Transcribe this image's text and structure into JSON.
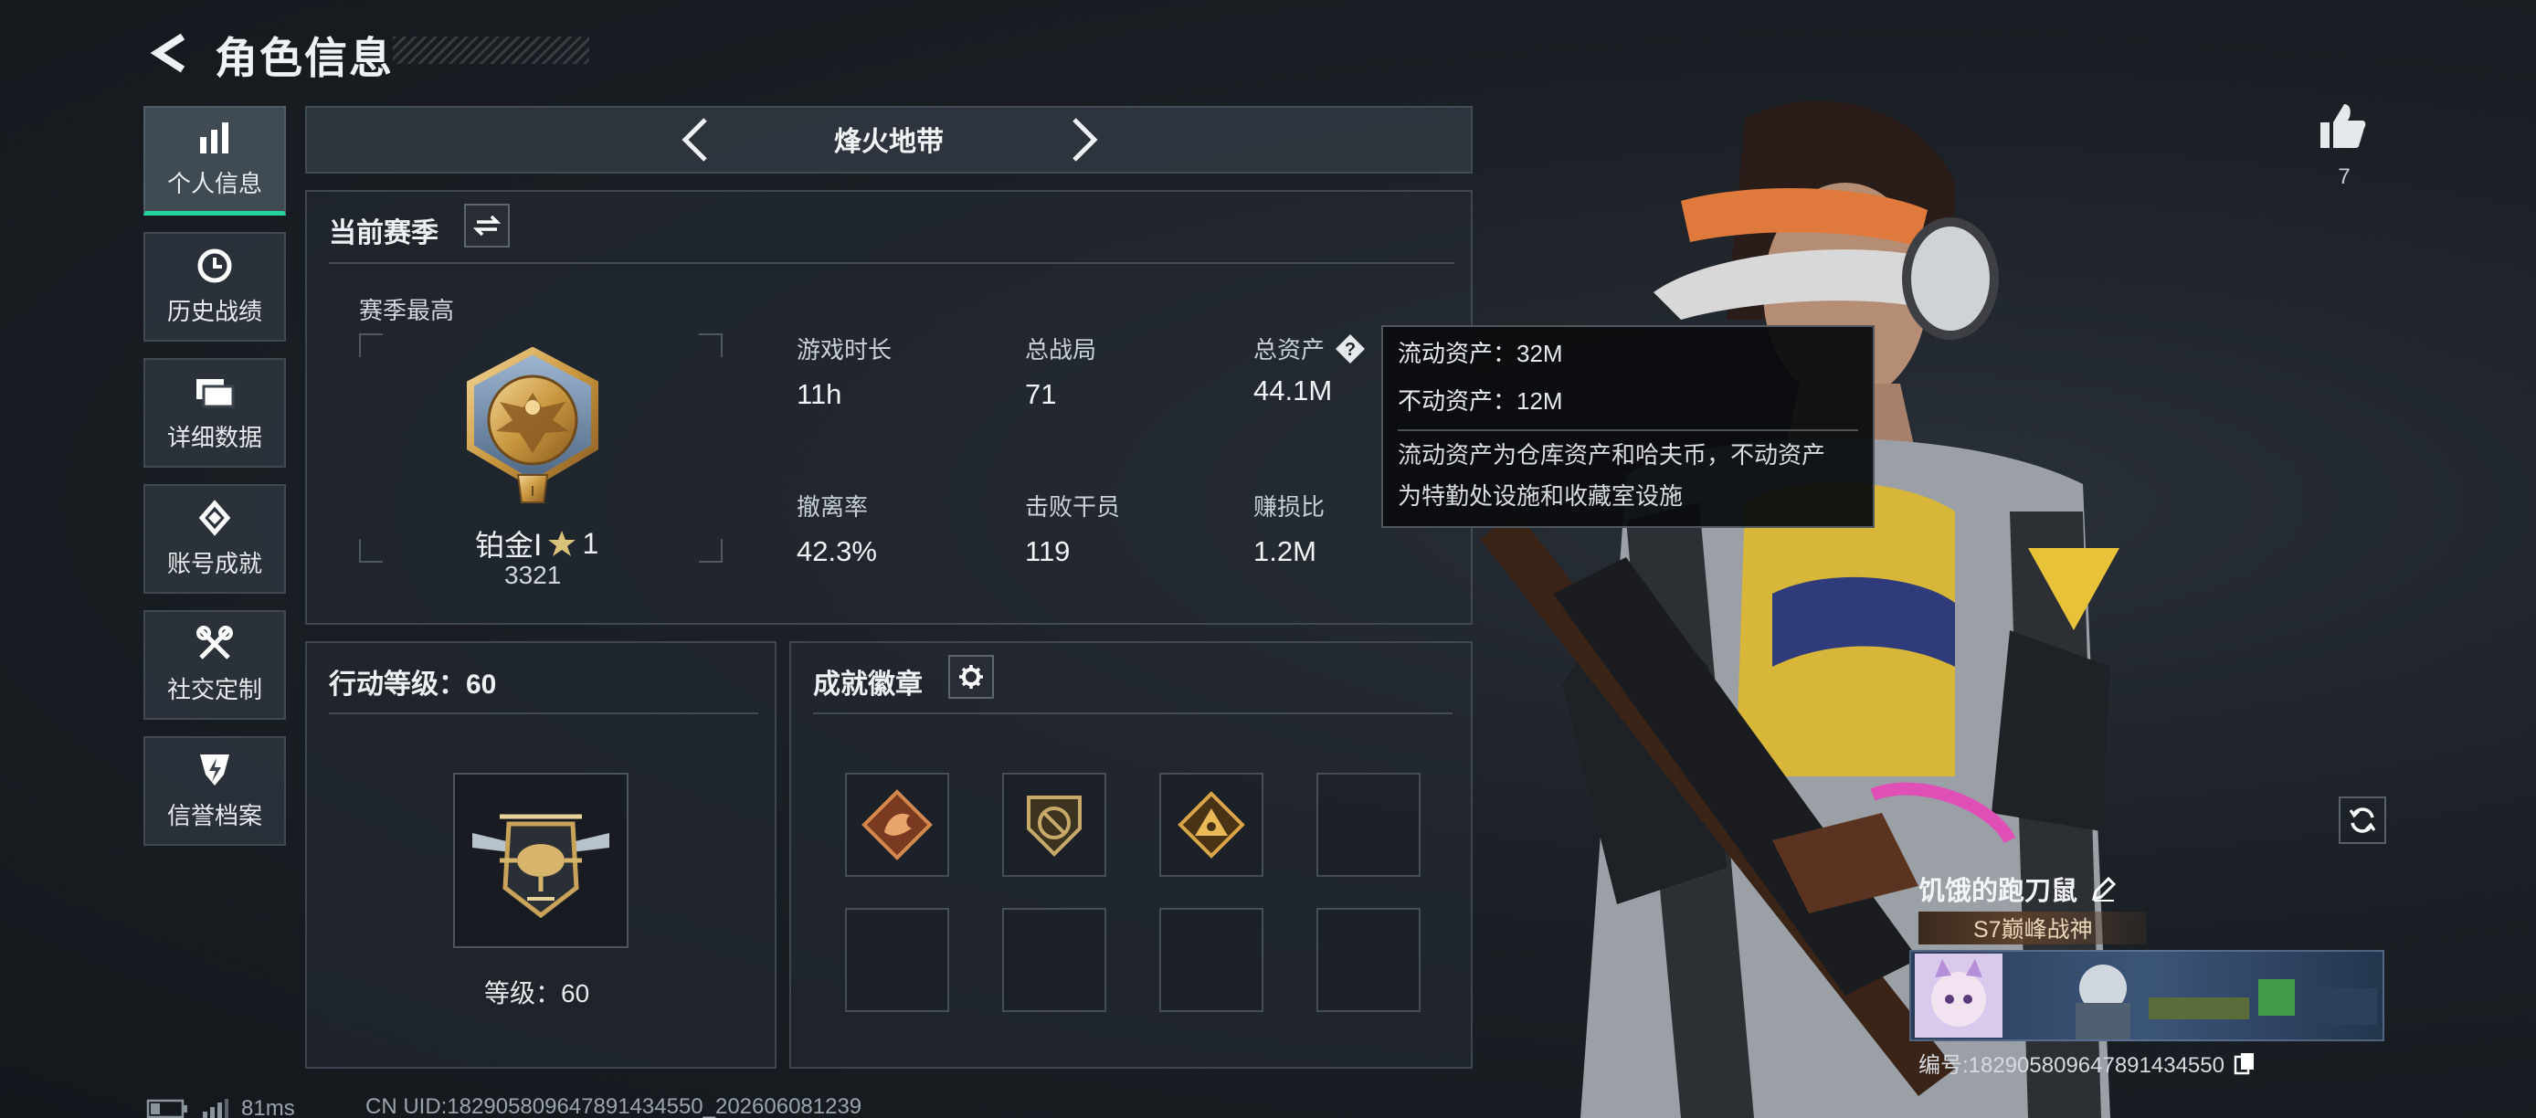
{
  "header": {
    "title": "角色信息"
  },
  "nav": [
    {
      "label": "个人信息",
      "icon": "bar-chart-icon",
      "active": true
    },
    {
      "label": "历史战绩",
      "icon": "history-clock-icon"
    },
    {
      "label": "详细数据",
      "icon": "folder-icon"
    },
    {
      "label": "账号成就",
      "icon": "achievement-diamond-icon"
    },
    {
      "label": "社交定制",
      "icon": "tools-icon"
    },
    {
      "label": "信誉档案",
      "icon": "shield-lightning-icon"
    }
  ],
  "mode": {
    "label": "烽火地带"
  },
  "season": {
    "title": "当前赛季",
    "best_label": "赛季最高",
    "rank_name": "铂金Ⅰ",
    "rank_stars": "1",
    "rank_score": "3321",
    "stats": [
      {
        "label": "游戏时长",
        "value": "11h"
      },
      {
        "label": "总战局",
        "value": "71"
      },
      {
        "label": "总资产",
        "value": "44.1M"
      },
      {
        "label": "撤离率",
        "value": "42.3%"
      },
      {
        "label": "击败干员",
        "value": "119"
      },
      {
        "label": "赚损比",
        "value": "1.2M"
      }
    ]
  },
  "tooltip": {
    "liquid": "流动资产：32M",
    "fixed": "不动资产：12M",
    "desc1": "流动资产为仓库资产和哈夫币，不动资产",
    "desc2": "为特勤处设施和收藏室设施"
  },
  "action_level": {
    "title": "行动等级：60",
    "level_text": "等级：60"
  },
  "achievements": {
    "title": "成就徽章",
    "filled_slots": 3,
    "total_slots": 8
  },
  "likes": {
    "count": "7"
  },
  "player": {
    "name": "饥饿的跑刀鼠",
    "title_badge": "S7巅峰战神",
    "id_text": "编号:182905809647891434550"
  },
  "status_bar": {
    "ping": "81ms",
    "uid": "CN UID:182905809647891434550_202606081239"
  },
  "colors": {
    "accent": "#26d4a0",
    "gold": "#c9a35a",
    "panel": "#262c34"
  }
}
